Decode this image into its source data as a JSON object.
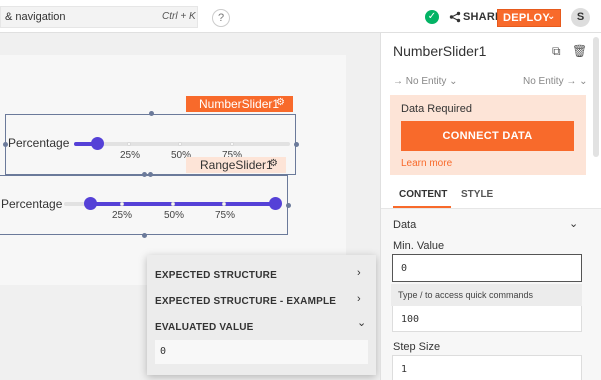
{
  "topbar": {
    "search_text": "& navigation",
    "search_shortcut": "Ctrl + K",
    "help_label": "?",
    "status_icon": "check-circle-icon",
    "share_label": "SHARE",
    "deploy_label": "DEPLOY",
    "avatar_initial": "S",
    "accent_color": "#f86a2b"
  },
  "canvas": {
    "number_slider": {
      "name": "NumberSlider1",
      "label": "Percentage",
      "value_percent": 10,
      "tick_labels": [
        "25%",
        "50%",
        "75%"
      ]
    },
    "range_slider": {
      "name": "RangeSlider1",
      "label": "Percentage",
      "start_percent": 12,
      "end_percent": 98,
      "tick_labels": [
        "25%",
        "50%",
        "75%"
      ]
    },
    "slider_color": "#5541d7"
  },
  "evaluated_panel": {
    "rows": [
      {
        "label": "EXPECTED STRUCTURE",
        "chevron": "›"
      },
      {
        "label": "EXPECTED STRUCTURE - EXAMPLE",
        "chevron": "›"
      },
      {
        "label": "EVALUATED VALUE",
        "chevron": "⌄"
      }
    ],
    "evaluated_value": "0"
  },
  "property_panel": {
    "title": "NumberSlider1",
    "entity_left": "→ No Entity ⌄",
    "entity_right": "No Entity → ⌄",
    "data_required_title": "Data Required",
    "connect_label": "CONNECT DATA",
    "learn_more_label": "Learn more",
    "tabs": [
      "CONTENT",
      "STYLE"
    ],
    "section_title": "Data",
    "min_label": "Min. Value",
    "min_value": "0",
    "command_hint": "Type / to access quick commands",
    "max_value": "100",
    "step_label": "Step Size",
    "step_value": "1"
  }
}
